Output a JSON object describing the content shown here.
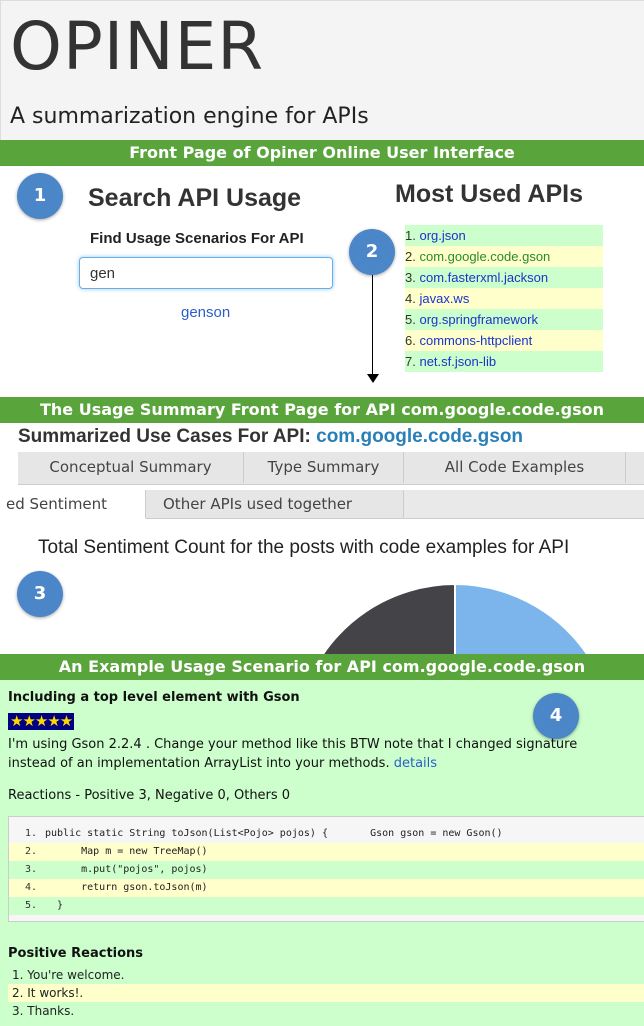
{
  "header": {
    "logo_text": "OPINER",
    "tagline": "A summarization engine for APIs"
  },
  "section_bars": {
    "front_page": "Front Page of Opiner Online User Interface",
    "summary_page": "The Usage Summary Front Page for API com.google.code.gson",
    "example_page": "An Example Usage Scenario for API com.google.code.gson"
  },
  "badges": [
    "1",
    "2",
    "3",
    "4"
  ],
  "search": {
    "heading": "Search API Usage",
    "label": "Find Usage Scenarios For API",
    "value": "gen",
    "suggestion": "genson"
  },
  "most_used": {
    "heading": "Most Used APIs",
    "items": [
      {
        "num": "1.",
        "label": "org.json",
        "color": "#ccffcc"
      },
      {
        "num": "2.",
        "label": "com.google.code.gson",
        "color": "#ffffcc"
      },
      {
        "num": "3.",
        "label": "com.fasterxml.jackson",
        "color": "#ccffcc"
      },
      {
        "num": "4.",
        "label": "javax.ws",
        "color": "#ffffcc"
      },
      {
        "num": "5.",
        "label": "org.springframework",
        "color": "#ccffcc"
      },
      {
        "num": "6.",
        "label": "commons-httpclient",
        "color": "#ffffcc"
      },
      {
        "num": "7.",
        "label": "net.sf.json-lib",
        "color": "#ccffcc"
      }
    ]
  },
  "summary": {
    "title_prefix": "Summarized Use Cases For API:",
    "title_api": "com.google.code.gson",
    "tabs": [
      "Conceptual Summary",
      "Type Summary",
      "All Code Examples"
    ],
    "subtabs": [
      "ed Sentiment",
      "Other APIs used together"
    ],
    "sentiment_text": "Total Sentiment Count for the posts with code examples for API",
    "pie_colors": [
      "#434348",
      "#7cb5ec"
    ]
  },
  "example": {
    "title": "Including a top level element with Gson",
    "stars": "★★★★★",
    "rating": 5,
    "text_line1": "I'm using Gson 2.2.4 . Change your method like this BTW note that I changed signature",
    "text_line2": "instead of an implementation ArrayList into your methods.",
    "details_link": "details",
    "reactions": "Reactions - Positive 3, Negative 0, Others 0",
    "code": [
      {
        "num": "1.",
        "text": "public static String toJson(List<Pojo> pojos) {       Gson gson = new Gson()"
      },
      {
        "num": "2.",
        "text": "      Map m = new TreeMap()"
      },
      {
        "num": "3.",
        "text": "      m.put(\"pojos\", pojos)"
      },
      {
        "num": "4.",
        "text": "      return gson.toJson(m)"
      },
      {
        "num": "5.",
        "text": "  }"
      }
    ],
    "positive_title": "Positive Reactions",
    "positive_items": [
      "1. You're welcome.",
      "2. It works!.",
      "3. Thanks."
    ]
  }
}
